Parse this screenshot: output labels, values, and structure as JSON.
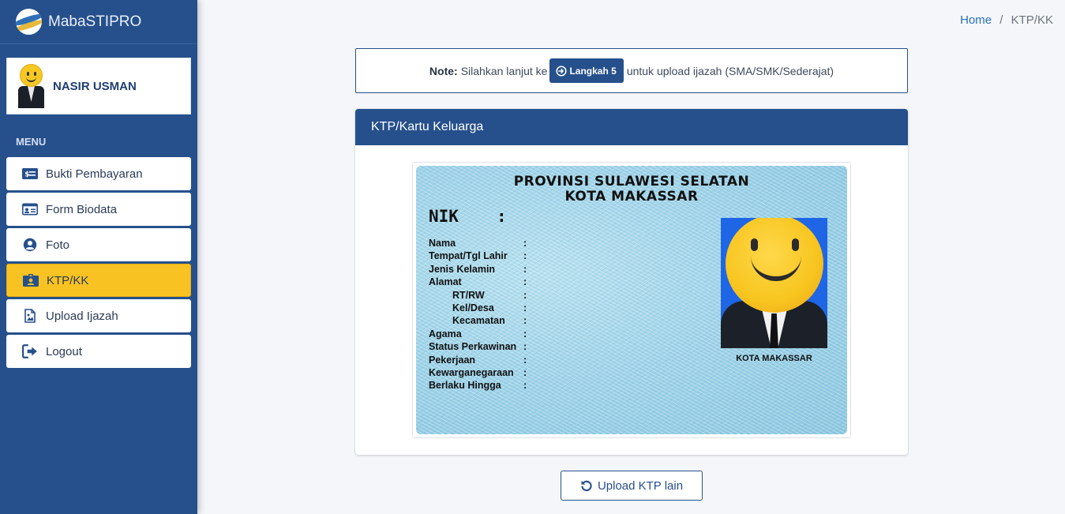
{
  "brand": {
    "name": "MabaSTIPRO"
  },
  "user": {
    "name": "NASIR USMAN"
  },
  "menu": {
    "header": "MENU",
    "items": [
      {
        "label": "Bukti Pembayaran",
        "icon": "money-bill-icon"
      },
      {
        "label": "Form Biodata",
        "icon": "id-card-icon"
      },
      {
        "label": "Foto",
        "icon": "user-circle-icon"
      },
      {
        "label": "KTP/KK",
        "icon": "id-badge-icon",
        "active": true
      },
      {
        "label": "Upload Ijazah",
        "icon": "file-image-icon"
      },
      {
        "label": "Logout",
        "icon": "sign-out-icon"
      }
    ]
  },
  "breadcrumb": {
    "home": "Home",
    "separator": "/",
    "current": "KTP/KK"
  },
  "note": {
    "label": "Note:",
    "text_before": "Silahkan lanjut ke",
    "button": "Langkah 5",
    "text_after": "untuk upload ijazah (SMA/SMK/Sederajat)"
  },
  "card": {
    "title": "KTP/Kartu Keluarga"
  },
  "ktp": {
    "province": "PROVINSI SULAWESI SELATAN",
    "city": "KOTA MAKASSAR",
    "nik_label": "NIK",
    "fields": [
      "Nama",
      "Tempat/Tgl Lahir",
      "Jenis Kelamin",
      "Alamat",
      "RT/RW",
      "Kel/Desa",
      "Kecamatan",
      "Agama",
      "Status Perkawinan",
      "Pekerjaan",
      "Kewarganegaraan",
      "Berlaku Hingga"
    ],
    "photo_caption": "KOTA MAKASSAR"
  },
  "actions": {
    "upload_other": "Upload KTP lain"
  },
  "colors": {
    "primary": "#26508c",
    "active_menu": "#f8c322",
    "background": "#f4f6f9"
  }
}
